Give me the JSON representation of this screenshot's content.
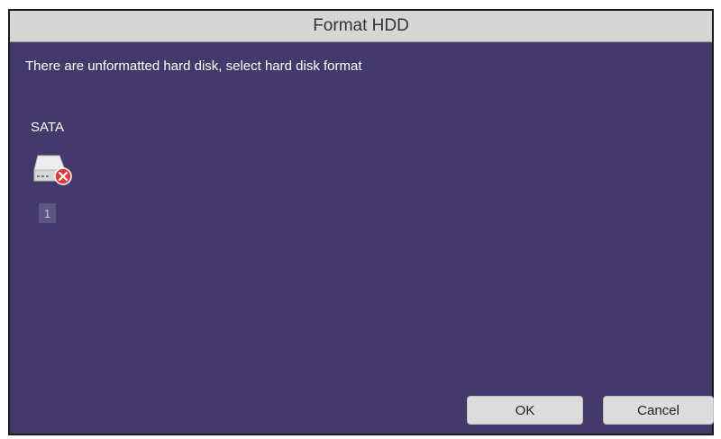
{
  "dialog": {
    "title": "Format HDD",
    "message": "There are unformatted hard disk, select hard disk format"
  },
  "disk_group": {
    "label": "SATA",
    "disks": [
      {
        "index": "1",
        "icon": "hdd-error-icon",
        "status": "unformatted"
      }
    ]
  },
  "buttons": {
    "ok_label": "OK",
    "cancel_label": "Cancel"
  },
  "colors": {
    "background": "#433a6b",
    "titlebar": "#d6d6d6",
    "error_badge": "#e53935"
  }
}
